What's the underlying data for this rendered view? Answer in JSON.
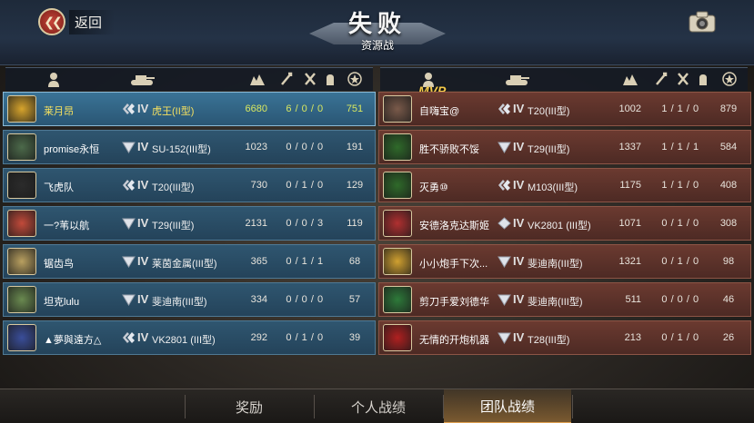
{
  "header": {
    "back_label": "返回",
    "title": "失败",
    "subtitle": "资源战"
  },
  "mvp_label": "MVP",
  "left_team": [
    {
      "name": "莱月昂",
      "tier": "IV",
      "tank": "虎王(II型)",
      "damage": "6680",
      "kda": "6 / 0 / 0",
      "score": "751",
      "rank": "diamond",
      "me": true
    },
    {
      "name": "promise永恒",
      "tier": "IV",
      "tank": "SU-152(III型)",
      "damage": "1023",
      "kda": "0 / 0 / 0",
      "score": "191",
      "rank": "silver"
    },
    {
      "name": "飞虎队",
      "tier": "IV",
      "tank": "T20(III型)",
      "damage": "730",
      "kda": "0 / 1 / 0",
      "score": "129",
      "rank": "diamond"
    },
    {
      "name": "一?苇以航",
      "tier": "IV",
      "tank": "T29(III型)",
      "damage": "2131",
      "kda": "0 / 0 / 3",
      "score": "119",
      "rank": "silver"
    },
    {
      "name": "锯齿鸟",
      "tier": "IV",
      "tank": "莱茵金属(III型)",
      "damage": "365",
      "kda": "0 / 1 / 1",
      "score": "68",
      "rank": "silver"
    },
    {
      "name": "坦克lulu",
      "tier": "IV",
      "tank": "斐迪南(III型)",
      "damage": "334",
      "kda": "0 / 0 / 0",
      "score": "57",
      "rank": "silver"
    },
    {
      "name": "▲夢與遠方△",
      "tier": "IV",
      "tank": "VK2801 (III型)",
      "damage": "292",
      "kda": "0 / 1 / 0",
      "score": "39",
      "rank": "diamond"
    }
  ],
  "right_team": [
    {
      "name": "自嗨宝@",
      "tier": "IV",
      "tank": "T20(III型)",
      "damage": "1002",
      "kda": "1 / 1 / 0",
      "score": "879",
      "rank": "diamond",
      "mvp": true
    },
    {
      "name": "胜不骄败不馁",
      "tier": "IV",
      "tank": "T29(III型)",
      "damage": "1337",
      "kda": "1 / 1 / 1",
      "score": "584",
      "rank": "silver"
    },
    {
      "name": "灭勇⑩",
      "tier": "IV",
      "tank": "M103(III型)",
      "damage": "1175",
      "kda": "1 / 1 / 0",
      "score": "408",
      "rank": "diamond"
    },
    {
      "name": "安德洛克达斯姬",
      "tier": "IV",
      "tank": "VK2801 (III型)",
      "damage": "1071",
      "kda": "0 / 1 / 0",
      "score": "308",
      "rank": "gem"
    },
    {
      "name": "小小炮手下次...",
      "tier": "IV",
      "tank": "斐迪南(III型)",
      "damage": "1321",
      "kda": "0 / 1 / 0",
      "score": "98",
      "rank": "silver"
    },
    {
      "name": "剪刀手爱刘德华",
      "tier": "IV",
      "tank": "斐迪南(III型)",
      "damage": "511",
      "kda": "0 / 0 / 0",
      "score": "46",
      "rank": "silver"
    },
    {
      "name": "无情的开炮机器",
      "tier": "IV",
      "tank": "T28(III型)",
      "damage": "213",
      "kda": "0 / 1 / 0",
      "score": "26",
      "rank": "silver"
    }
  ],
  "tabs": [
    {
      "label": "奖励"
    },
    {
      "label": "个人战绩"
    },
    {
      "label": "团队战绩",
      "active": true
    }
  ],
  "colors": {
    "left_row": "#2f5670",
    "right_row": "#6b3a30",
    "highlight_text": "#f4e060",
    "mvp": "#f3c84a"
  }
}
